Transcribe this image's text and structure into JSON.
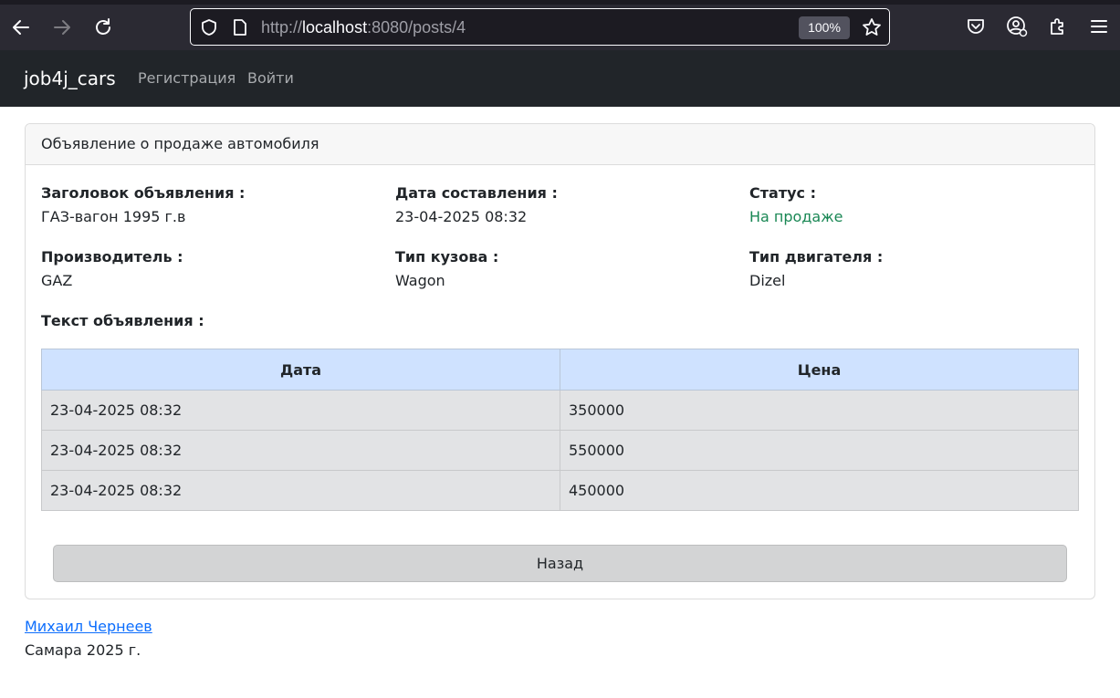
{
  "browser": {
    "url_prefix": "http://",
    "url_host": "localhost",
    "url_rest": ":8080/posts/4",
    "zoom": "100%"
  },
  "navbar": {
    "brand": "job4j_cars",
    "links": [
      "Регистрация",
      "Войти"
    ]
  },
  "card": {
    "header": "Объявление о продаже автомобиля",
    "fields": {
      "title_label": "Заголовок объявления :",
      "title_value": "ГАЗ-вагон 1995 г.в",
      "date_label": "Дата составления :",
      "date_value": "23-04-2025 08:32",
      "status_label": "Статус :",
      "status_value": "На продаже",
      "maker_label": "Производитель :",
      "maker_value": "GAZ",
      "body_label": "Тип кузова :",
      "body_value": "Wagon",
      "engine_label": "Тип двигателя :",
      "engine_value": "Dizel",
      "text_label": "Текст объявления :"
    },
    "table": {
      "headers": [
        "Дата",
        "Цена"
      ],
      "rows": [
        [
          "23-04-2025 08:32",
          "350000"
        ],
        [
          "23-04-2025 08:32",
          "550000"
        ],
        [
          "23-04-2025 08:32",
          "450000"
        ]
      ]
    },
    "back_label": "Назад"
  },
  "footer": {
    "author": "Михаил Чернеев",
    "city": "Самара 2025 г."
  },
  "colors": {
    "status": "#198754",
    "table_header": "#cfe2ff",
    "table_row": "#e2e3e5",
    "navbar": "#212529",
    "link": "#0d6efd"
  }
}
